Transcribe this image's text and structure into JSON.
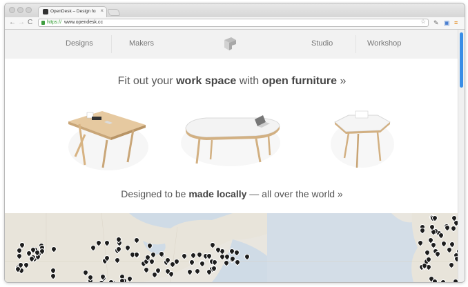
{
  "browser": {
    "tab_title": "OpenDesk – Design for Cu",
    "tab_close": "×",
    "url_scheme": "https://",
    "url_host": "www.opendesk.cc",
    "icons": [
      "back-icon",
      "forward-icon",
      "reload-icon",
      "lock-icon",
      "star-icon",
      "wrench-icon",
      "extension-icon",
      "menu-icon"
    ]
  },
  "site_nav": {
    "items": [
      "Designs",
      "Makers",
      "Studio",
      "Workshop"
    ],
    "logo": "opendesk-logo-icon"
  },
  "hero": {
    "prefix": "Fit out your ",
    "bold1": "work space",
    "middle": " with ",
    "bold2": "open furniture",
    "suffix": " »"
  },
  "products": [
    "desk-product-image",
    "table-product-image",
    "round-table-product-image"
  ],
  "makers": {
    "prefix": "Designed to be ",
    "bold": "made locally",
    "suffix": " — all over the world »"
  },
  "map": {
    "pin_color": "#1d1d1d",
    "land_color": "#e9e6df",
    "water_color": "#cfdbe6"
  }
}
